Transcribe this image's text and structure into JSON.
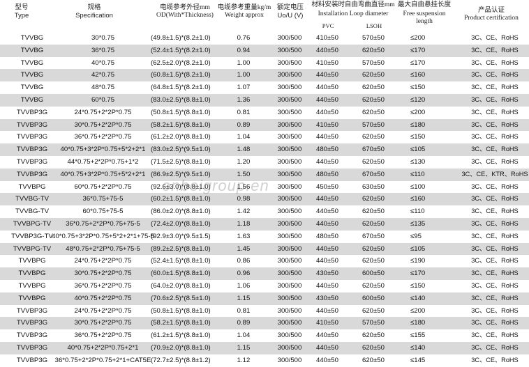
{
  "header": {
    "type_cn": "型号",
    "type_en": "Type",
    "spec_cn": "规格",
    "spec_en": "Specification",
    "od_cn": "电缆参考外径mm",
    "od_en": "OD(With*Thickness)",
    "weight_cn": "电缆参考重量kg/m",
    "weight_en": "Weight approx",
    "voltage_cn": "额定电压",
    "voltage_en": "Uo/U (V)",
    "loop_cn": "材料安装时自由弯曲直径mm",
    "loop_en": "Installation Loop diameter",
    "pvc": "PVC",
    "lsoh": "LSOH",
    "susp_cn": "最大自由悬挂长度",
    "susp_en1": "Free suspension",
    "susp_en2": "length",
    "cert_cn": "产品认证",
    "cert_en": "Product certification"
  },
  "watermark": "onbeigroup.en",
  "rows": [
    {
      "type": "TVVBG",
      "spec": "30*0.75",
      "od": "(49.8±1.5)*(8.2±1.0)",
      "weight": "0.76",
      "voltage": "300/500",
      "pvc": "410±50",
      "lsoh": "570±50",
      "susp": "≤200",
      "cert": "3C、CE、RoHS"
    },
    {
      "type": "TVVBG",
      "spec": "36*0.75",
      "od": "(52.4±1.5)*(8.2±1.0)",
      "weight": "0.94",
      "voltage": "300/500",
      "pvc": "440±50",
      "lsoh": "620±50",
      "susp": "≤170",
      "cert": "3C、CE、RoHS"
    },
    {
      "type": "TVVBG",
      "spec": "40*0.75",
      "od": "(62.5±2.0)*(8.2±1.0)",
      "weight": "1.00",
      "voltage": "300/500",
      "pvc": "410±50",
      "lsoh": "570±50",
      "susp": "≤170",
      "cert": "3C、CE、RoHS"
    },
    {
      "type": "TVVBG",
      "spec": "42*0.75",
      "od": "(60.8±1.5)*(8.2±1.0)",
      "weight": "1.00",
      "voltage": "300/500",
      "pvc": "440±50",
      "lsoh": "620±50",
      "susp": "≤160",
      "cert": "3C、CE、RoHS"
    },
    {
      "type": "TVVBG",
      "spec": "48*0.75",
      "od": "(64.8±1.5)*(8.2±1.0)",
      "weight": "1.07",
      "voltage": "300/500",
      "pvc": "440±50",
      "lsoh": "620±50",
      "susp": "≤150",
      "cert": "3C、CE、RoHS"
    },
    {
      "type": "TVVBG",
      "spec": "60*0.75",
      "od": "(83.0±2.5)*(8.8±1.0)",
      "weight": "1.36",
      "voltage": "300/500",
      "pvc": "440±50",
      "lsoh": "620±50",
      "susp": "≤120",
      "cert": "3C、CE、RoHS"
    },
    {
      "type": "TVVBP3G",
      "spec": "24*0.75+2*2P*0.75",
      "od": "(50.8±1.5)*(8.8±1.0)",
      "weight": "0.81",
      "voltage": "300/500",
      "pvc": "440±50",
      "lsoh": "620±50",
      "susp": "≤200",
      "cert": "3C、CE、RoHS"
    },
    {
      "type": "TVVBP3G",
      "spec": "30*0.75+2*2P*0.75",
      "od": "(58.2±1.5)*(8.8±1.0)",
      "weight": "0.89",
      "voltage": "300/500",
      "pvc": "410±50",
      "lsoh": "570±50",
      "susp": "≤180",
      "cert": "3C、CE、RoHS"
    },
    {
      "type": "TVVBP3G",
      "spec": "36*0.75+2*2P*0.75",
      "od": "(61.2±2.0)*(8.8±1.0)",
      "weight": "1.04",
      "voltage": "300/500",
      "pvc": "440±50",
      "lsoh": "620±50",
      "susp": "≤150",
      "cert": "3C、CE、RoHS"
    },
    {
      "type": "TVVBP3G",
      "spec": "40*0.75+3*2P*0.75+5*2+2*1",
      "od": "(83.0±2.5)*(9.5±1.0)",
      "weight": "1.48",
      "voltage": "300/500",
      "pvc": "480±50",
      "lsoh": "670±50",
      "susp": "≤105",
      "cert": "3C、CE、RoHS"
    },
    {
      "type": "TVVBP3G",
      "spec": "44*0.75+2*2P*0.75+1*2",
      "od": "(71.5±2.5)*(8.8±1.0)",
      "weight": "1.20",
      "voltage": "300/500",
      "pvc": "440±50",
      "lsoh": "620±50",
      "susp": "≤130",
      "cert": "3C、CE、RoHS"
    },
    {
      "type": "TVVBP3G",
      "spec": "40*0.75+3*2P*0.75+5*2+2*1",
      "od": "(86.9±2.5)*(9.5±1.0)",
      "weight": "1.50",
      "voltage": "300/500",
      "pvc": "480±50",
      "lsoh": "670±50",
      "susp": "≤110",
      "cert": "3C、CE、KTR、RoHS"
    },
    {
      "type": "TVVBPG",
      "spec": "60*0.75+2*2P*0.75",
      "od": "(92.6±3.0)*(8.8±1.0)",
      "weight": "1.56",
      "voltage": "300/500",
      "pvc": "450±50",
      "lsoh": "630±50",
      "susp": "≤100",
      "cert": "3C、CE、RoHS"
    },
    {
      "type": "TVVBG-TV",
      "spec": "36*0.75+75-5",
      "od": "(60.2±1.5)*(8.8±1.0)",
      "weight": "0.98",
      "voltage": "300/500",
      "pvc": "440±50",
      "lsoh": "620±50",
      "susp": "≤160",
      "cert": "3C、CE、RoHS"
    },
    {
      "type": "TVVBG-TV",
      "spec": "60*0.75+75-5",
      "od": "(86.0±2.0)*(8.8±1.0)",
      "weight": "1.42",
      "voltage": "300/500",
      "pvc": "440±50",
      "lsoh": "620±50",
      "susp": "≤110",
      "cert": "3C、CE、RoHS"
    },
    {
      "type": "TVVBPG-TV",
      "spec": "36*0.75+2*2P*0.75+75-5",
      "od": "(72.4±2.0)*(8.8±1.0)",
      "weight": "1.18",
      "voltage": "300/500",
      "pvc": "440±50",
      "lsoh": "620±50",
      "susp": "≤135",
      "cert": "3C、CE、RoHS"
    },
    {
      "type": "TVVBP3G-TV",
      "spec": "40*0.75+3*2P*0.75+5*2+2*1+75-5",
      "od": "(92.9±3.0)*(9.5±1.5)",
      "weight": "1.63",
      "voltage": "300/500",
      "pvc": "480±50",
      "lsoh": "670±50",
      "susp": "≤95",
      "cert": "3C、CE、RoHS"
    },
    {
      "type": "TVVBPG-TV",
      "spec": "48*0.75+2*2P*0.75+75-5",
      "od": "(89.2±2.5)*(8.8±1.0)",
      "weight": "1.45",
      "voltage": "300/500",
      "pvc": "440±50",
      "lsoh": "620±50",
      "susp": "≤105",
      "cert": "3C、CE、RoHS"
    },
    {
      "type": "TVVBPG",
      "spec": "24*0.75+2*2P*0.75",
      "od": "(52.4±1.5)*(8.8±1.0)",
      "weight": "0.86",
      "voltage": "300/500",
      "pvc": "440±50",
      "lsoh": "620±50",
      "susp": "≤190",
      "cert": "3C、CE、RoHS"
    },
    {
      "type": "TVVBPG",
      "spec": "30*0.75+2*2P*0.75",
      "od": "(60.0±1.5)*(8.8±1.0)",
      "weight": "0.96",
      "voltage": "300/500",
      "pvc": "430±50",
      "lsoh": "600±50",
      "susp": "≤170",
      "cert": "3C、CE、RoHS"
    },
    {
      "type": "TVVBPG",
      "spec": "36*0.75+2*2P*0.75",
      "od": "(64.0±2.0)*(8.8±1.0)",
      "weight": "1.06",
      "voltage": "300/500",
      "pvc": "440±50",
      "lsoh": "620±50",
      "susp": "≤150",
      "cert": "3C、CE、RoHS"
    },
    {
      "type": "TVVBPG",
      "spec": "40*0.75+2*2P*0.75",
      "od": "(70.6±2.5)*(8.5±1.0)",
      "weight": "1.15",
      "voltage": "300/500",
      "pvc": "430±50",
      "lsoh": "600±50",
      "susp": "≤140",
      "cert": "3C、CE、RoHS"
    },
    {
      "type": "TVVBP3G",
      "spec": "24*0.75+2*2P*0.75",
      "od": "(50.8±1.5)*(8.8±1.0)",
      "weight": "0.81",
      "voltage": "300/500",
      "pvc": "440±50",
      "lsoh": "620±50",
      "susp": "≤200",
      "cert": "3C、CE、RoHS"
    },
    {
      "type": "TVVBP3G",
      "spec": "30*0.75+2*2P*0.75",
      "od": "(58.2±1.5)*(8.8±1.0)",
      "weight": "0.89",
      "voltage": "300/500",
      "pvc": "410±50",
      "lsoh": "570±50",
      "susp": "≤180",
      "cert": "3C、CE、RoHS"
    },
    {
      "type": "TVVBP3G",
      "spec": "36*0.75+2*2P*0.75",
      "od": "(61.2±1.5)*(8.8±1.0)",
      "weight": "1.04",
      "voltage": "300/500",
      "pvc": "440±50",
      "lsoh": "620±50",
      "susp": "≤155",
      "cert": "3C、CE、RoHS"
    },
    {
      "type": "TVVBP3G",
      "spec": "40*0.75+2*2P*0.75+2*1",
      "od": "(70.9±2.0)*(8.8±1.0)",
      "weight": "1.15",
      "voltage": "300/500",
      "pvc": "440±50",
      "lsoh": "620±50",
      "susp": "≤140",
      "cert": "3C、CE、RoHS"
    },
    {
      "type": "TVVBP3G",
      "spec": "36*0.75+2*2P*0.75+2*1+CAT5E",
      "od": "(72.7±2.5)*(8.8±1.2)",
      "weight": "1.12",
      "voltage": "300/500",
      "pvc": "440±50",
      "lsoh": "620±50",
      "susp": "≤145",
      "cert": "3C、CE、RoHS"
    }
  ]
}
